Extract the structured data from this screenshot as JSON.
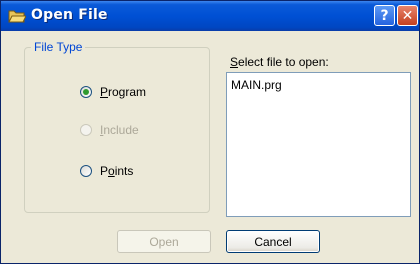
{
  "window": {
    "title": "Open File",
    "icon": "folder-open-icon",
    "help_label": "?",
    "close_label": "✕"
  },
  "file_type": {
    "legend": "File Type",
    "options": [
      {
        "label_prefix": "",
        "label_ul": "P",
        "label_rest": "rogram",
        "checked": true,
        "disabled": false
      },
      {
        "label_prefix": "",
        "label_ul": "I",
        "label_rest": "nclude",
        "checked": false,
        "disabled": true
      },
      {
        "label_prefix": "P",
        "label_ul": "o",
        "label_rest": "ints",
        "checked": false,
        "disabled": false
      }
    ]
  },
  "file_list": {
    "label_ul": "S",
    "label_rest": "elect file to open:",
    "items": [
      "MAIN.prg"
    ]
  },
  "buttons": {
    "open": "Open",
    "cancel": "Cancel"
  }
}
